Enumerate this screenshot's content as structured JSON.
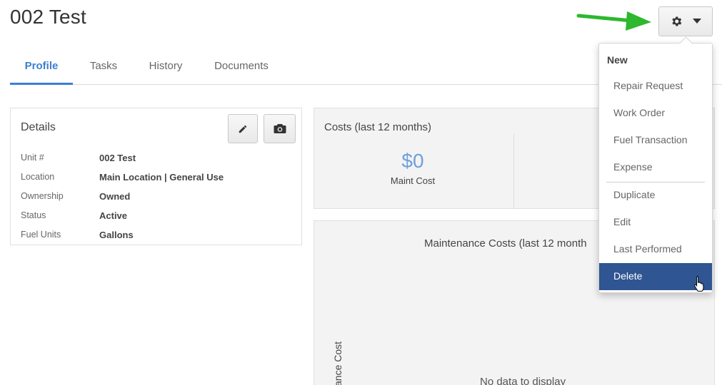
{
  "page": {
    "title": "002 Test"
  },
  "tabs": [
    {
      "label": "Profile",
      "active": true
    },
    {
      "label": "Tasks",
      "active": false
    },
    {
      "label": "History",
      "active": false
    },
    {
      "label": "Documents",
      "active": false
    }
  ],
  "details": {
    "title": "Details",
    "rows": [
      {
        "key": "Unit #",
        "value": "002 Test"
      },
      {
        "key": "Location",
        "value": "Main Location | General Use"
      },
      {
        "key": "Ownership",
        "value": "Owned"
      },
      {
        "key": "Status",
        "value": "Active"
      },
      {
        "key": "Fuel Units",
        "value": "Gallons"
      }
    ]
  },
  "costs": {
    "title": "Costs (last 12 months)",
    "maint_value": "$0",
    "maint_label": "Maint Cost"
  },
  "chart": {
    "title": "Maintenance Costs (last 12 month",
    "ylabel": "ance Cost",
    "empty_text": "No data to display"
  },
  "menu": {
    "header": "New",
    "items": [
      {
        "label": "Repair Request"
      },
      {
        "label": "Work Order"
      },
      {
        "label": "Fuel Transaction"
      },
      {
        "label": "Expense"
      },
      {
        "label": "Duplicate"
      },
      {
        "label": "Edit"
      },
      {
        "label": "Last Performed"
      },
      {
        "label": "Delete",
        "selected": true
      }
    ]
  },
  "colors": {
    "accent": "#3b7fd1",
    "menu_selected": "#2f5592",
    "arrow": "#2db82d",
    "cost_value": "#6fa0dc"
  },
  "icons": [
    "gear-icon",
    "caret-down-icon",
    "pencil-icon",
    "camera-icon",
    "green-arrow-icon",
    "hand-cursor-icon"
  ]
}
